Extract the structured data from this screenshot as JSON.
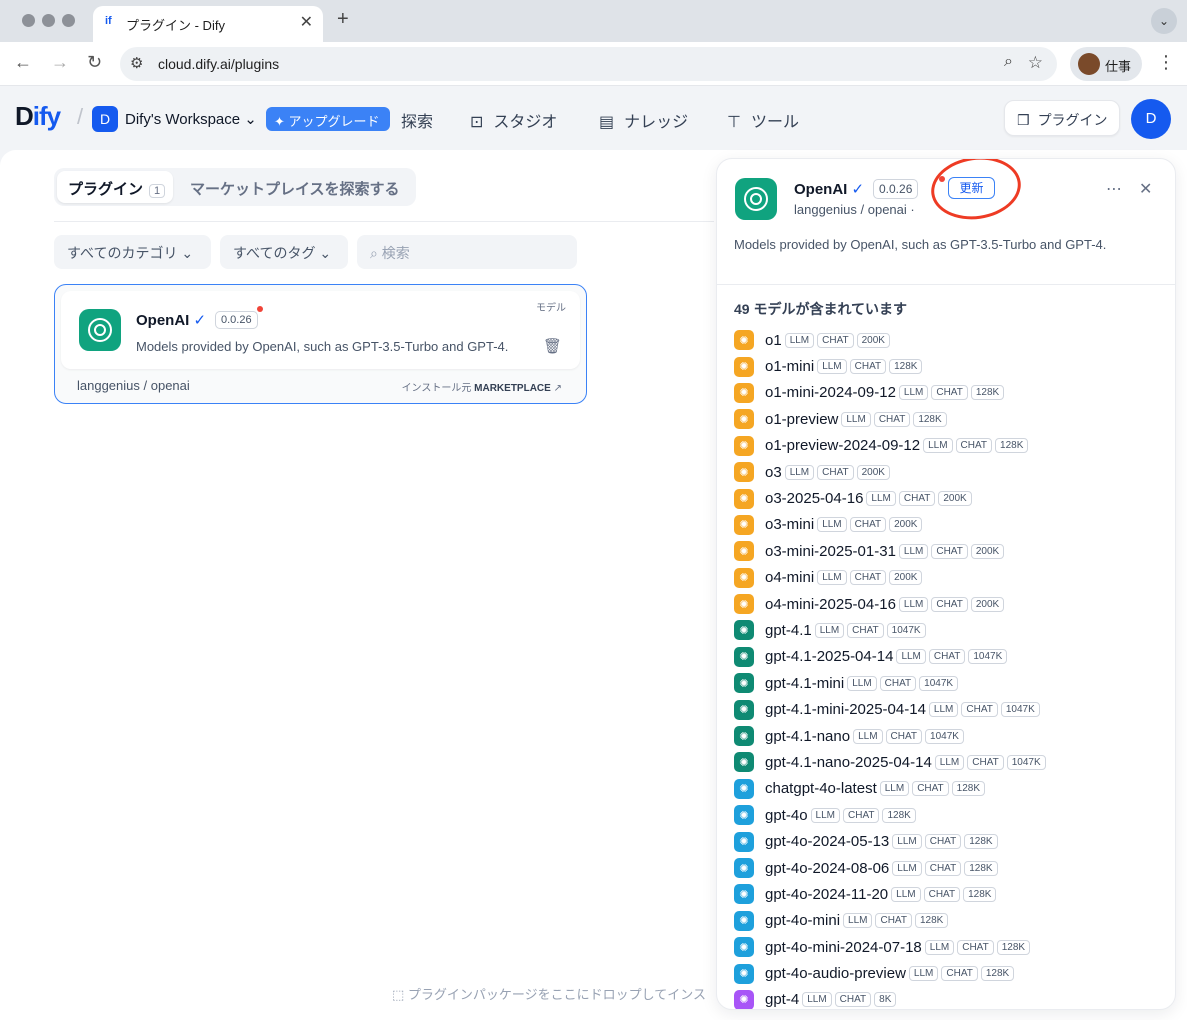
{
  "browser": {
    "tab_favicon": "if",
    "tab_title": "プラグイン - Dify",
    "url": "cloud.dify.ai/plugins",
    "profile_name": "仕事"
  },
  "header": {
    "logo_d": "D",
    "logo_ify": "ify",
    "workspace_initial": "D",
    "workspace_name": "Dify's Workspace",
    "upgrade_label": "アップグレード",
    "nav": [
      "探索",
      "スタジオ",
      "ナレッジ",
      "ツール"
    ],
    "plugin_button": "プラグイン",
    "user_initial": "D"
  },
  "main": {
    "tab_plugins": "プラグイン",
    "tab_plugins_count": "1",
    "tab_marketplace": "マーケットプレイスを探索する",
    "filter_category": "すべてのカテゴリ",
    "filter_tags": "すべてのタグ",
    "search_placeholder": "検索",
    "drop_hint": "プラグインパッケージをここにドロップしてインス"
  },
  "card": {
    "category": "モデル",
    "name": "OpenAI",
    "version": "0.0.26",
    "description": "Models provided by OpenAI, such as GPT-3.5-Turbo and GPT-4.",
    "org": "langgenius",
    "repo": "openai",
    "install_source_prefix": "インストール元",
    "install_source": "MARKETPLACE"
  },
  "panel": {
    "name": "OpenAI",
    "version": "0.0.26",
    "update_label": "更新",
    "author": "langgenius",
    "repo": "openai",
    "description": "Models provided by OpenAI, such as GPT-3.5-Turbo and GPT-4.",
    "models_count_label": "49 モデルが含まれています",
    "models": [
      {
        "name": "o1",
        "tags": [
          "LLM",
          "CHAT",
          "200K"
        ],
        "color": "#f5a623"
      },
      {
        "name": "o1-mini",
        "tags": [
          "LLM",
          "CHAT",
          "128K"
        ],
        "color": "#f5a623"
      },
      {
        "name": "o1-mini-2024-09-12",
        "tags": [
          "LLM",
          "CHAT",
          "128K"
        ],
        "color": "#f5a623"
      },
      {
        "name": "o1-preview",
        "tags": [
          "LLM",
          "CHAT",
          "128K"
        ],
        "color": "#f5a623"
      },
      {
        "name": "o1-preview-2024-09-12",
        "tags": [
          "LLM",
          "CHAT",
          "128K"
        ],
        "color": "#f5a623"
      },
      {
        "name": "o3",
        "tags": [
          "LLM",
          "CHAT",
          "200K"
        ],
        "color": "#f5a623"
      },
      {
        "name": "o3-2025-04-16",
        "tags": [
          "LLM",
          "CHAT",
          "200K"
        ],
        "color": "#f5a623"
      },
      {
        "name": "o3-mini",
        "tags": [
          "LLM",
          "CHAT",
          "200K"
        ],
        "color": "#f5a623"
      },
      {
        "name": "o3-mini-2025-01-31",
        "tags": [
          "LLM",
          "CHAT",
          "200K"
        ],
        "color": "#f5a623"
      },
      {
        "name": "o4-mini",
        "tags": [
          "LLM",
          "CHAT",
          "200K"
        ],
        "color": "#f5a623"
      },
      {
        "name": "o4-mini-2025-04-16",
        "tags": [
          "LLM",
          "CHAT",
          "200K"
        ],
        "color": "#f5a623"
      },
      {
        "name": "gpt-4.1",
        "tags": [
          "LLM",
          "CHAT",
          "1047K"
        ],
        "color": "#0f8a73"
      },
      {
        "name": "gpt-4.1-2025-04-14",
        "tags": [
          "LLM",
          "CHAT",
          "1047K"
        ],
        "color": "#0f8a73"
      },
      {
        "name": "gpt-4.1-mini",
        "tags": [
          "LLM",
          "CHAT",
          "1047K"
        ],
        "color": "#0f8a73"
      },
      {
        "name": "gpt-4.1-mini-2025-04-14",
        "tags": [
          "LLM",
          "CHAT",
          "1047K"
        ],
        "color": "#0f8a73"
      },
      {
        "name": "gpt-4.1-nano",
        "tags": [
          "LLM",
          "CHAT",
          "1047K"
        ],
        "color": "#0f8a73"
      },
      {
        "name": "gpt-4.1-nano-2025-04-14",
        "tags": [
          "LLM",
          "CHAT",
          "1047K"
        ],
        "color": "#0f8a73"
      },
      {
        "name": "chatgpt-4o-latest",
        "tags": [
          "LLM",
          "CHAT",
          "128K"
        ],
        "color": "#1ea0dc"
      },
      {
        "name": "gpt-4o",
        "tags": [
          "LLM",
          "CHAT",
          "128K"
        ],
        "color": "#1ea0dc"
      },
      {
        "name": "gpt-4o-2024-05-13",
        "tags": [
          "LLM",
          "CHAT",
          "128K"
        ],
        "color": "#1ea0dc"
      },
      {
        "name": "gpt-4o-2024-08-06",
        "tags": [
          "LLM",
          "CHAT",
          "128K"
        ],
        "color": "#1ea0dc"
      },
      {
        "name": "gpt-4o-2024-11-20",
        "tags": [
          "LLM",
          "CHAT",
          "128K"
        ],
        "color": "#1ea0dc"
      },
      {
        "name": "gpt-4o-mini",
        "tags": [
          "LLM",
          "CHAT",
          "128K"
        ],
        "color": "#1ea0dc"
      },
      {
        "name": "gpt-4o-mini-2024-07-18",
        "tags": [
          "LLM",
          "CHAT",
          "128K"
        ],
        "color": "#1ea0dc"
      },
      {
        "name": "gpt-4o-audio-preview",
        "tags": [
          "LLM",
          "CHAT",
          "128K"
        ],
        "color": "#1ea0dc"
      },
      {
        "name": "gpt-4",
        "tags": [
          "LLM",
          "CHAT",
          "8K"
        ],
        "color": "#a855f7"
      }
    ]
  },
  "colors": {
    "accent": "#155aef",
    "openai_green": "#10a37f",
    "annotation_red": "#ee3b24"
  }
}
